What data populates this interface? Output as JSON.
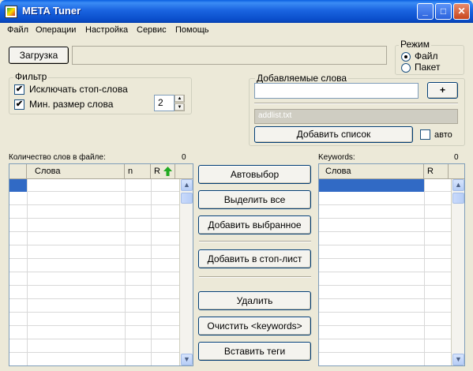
{
  "window": {
    "title": "META Tuner",
    "buttons": {
      "minimize": "_",
      "maximize": "□",
      "close": "✕"
    }
  },
  "menu": [
    "Файл",
    "Операции",
    "Настройка",
    "Сервис",
    "Помощь"
  ],
  "load": {
    "button_label": "Загрузка",
    "path_value": ""
  },
  "mode": {
    "label": "Режим",
    "options": [
      {
        "label": "Файл",
        "selected": true
      },
      {
        "label": "Пакет",
        "selected": false
      }
    ]
  },
  "filter": {
    "label": "Фильтр",
    "exclude_stopwords": {
      "label": "Исключать стоп-слова",
      "checked": true
    },
    "min_word_size": {
      "label": "Мин. размер слова",
      "checked": true,
      "value": "2"
    }
  },
  "added_words": {
    "label": "Добавляемые слова",
    "input_value": "",
    "plus_label": "+",
    "list_file": "addlist.txt",
    "add_list_label": "Добавить список",
    "auto_label": "авто",
    "auto_checked": false
  },
  "left_grid": {
    "count_label": "Количество слов в файле:",
    "count_value": "0",
    "columns": [
      "Слова",
      "n",
      "R"
    ],
    "sort_icon": "green-up-arrow-icon"
  },
  "right_grid": {
    "count_label": "Keywords:",
    "count_value": "0",
    "columns": [
      "Слова",
      "R"
    ]
  },
  "actions": {
    "auto_select": "Автовыбор",
    "select_all": "Выделить все",
    "add_selected": "Добавить выбранное",
    "add_to_stoplist": "Добавить в стоп-лист",
    "delete": "Удалить",
    "clear_keywords": "Очистить <keywords>",
    "insert_tags": "Вставить теги"
  },
  "colors": {
    "selection": "#316ac5",
    "titlebar": "#0a4ecb",
    "sort_arrow": "#22aa22"
  }
}
